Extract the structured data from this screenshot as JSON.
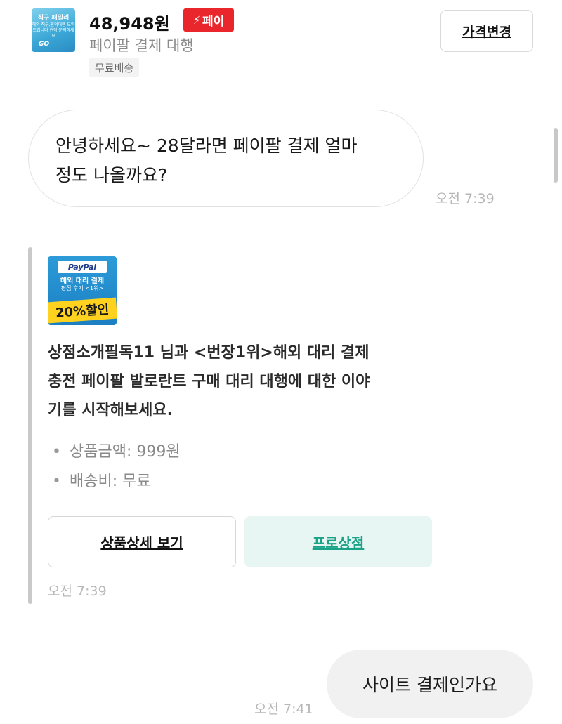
{
  "header": {
    "thumbnail": {
      "line1": "직구 패밀리",
      "line2": "해외 직구,편의대행 도와드립니다 견적 문의하세요",
      "logo": "GO"
    },
    "price": "48,948원",
    "pay_badge": {
      "icon": "lightning-icon",
      "label": "페이",
      "color": "#e8262b"
    },
    "product_name": "페이팔 결제 대행",
    "shipping_tag": "무료배송",
    "price_change_button": "가격변경"
  },
  "messages": {
    "incoming_1": {
      "text_line1": "안녕하세요~ 28달라면 페이팔 결제 얼마",
      "text_line2": "정도 나올까요?",
      "time": "오전 7:39"
    },
    "product_card": {
      "thumbnail": {
        "brand": "PayPal",
        "line1": "해외 대리 결제",
        "line2": "평점 후기 <1위>",
        "discount": "20%할인"
      },
      "text_line1": "상점소개필독11 님과 <번장1위>해외 대리 결제",
      "text_line2": "충전 페이팔 발로란트 구매 대리 대행에 대한 이야",
      "text_line3": "기를 시작해보세요.",
      "info": [
        "상품금액: 999원",
        "배송비: 무료"
      ],
      "detail_button": "상품상세 보기",
      "shop_button": "프로상점",
      "time": "오전 7:39"
    },
    "outgoing_1": {
      "text": "사이트 결제인가요",
      "time": "오전 7:41"
    }
  },
  "colors": {
    "accent_green": "#1aa386",
    "shop_button_bg": "#e8f6f3",
    "pay_red": "#e8262b"
  }
}
